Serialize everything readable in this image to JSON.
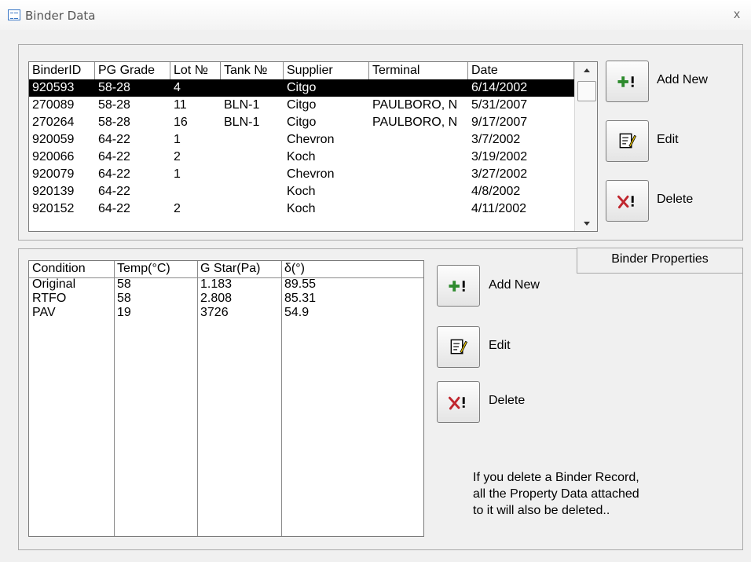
{
  "window": {
    "title": "Binder Data",
    "close_label": "x"
  },
  "binder_list": {
    "columns": [
      "BinderID",
      "PG Grade",
      "Lot №",
      "Tank №",
      "Supplier",
      "Terminal",
      "Date"
    ],
    "rows": [
      [
        "920593",
        "58-28",
        "4",
        "",
        "Citgo",
        "",
        "6/14/2002"
      ],
      [
        "270089",
        "58-28",
        "11",
        "BLN-1",
        "Citgo",
        "PAULBORO, N",
        "5/31/2007"
      ],
      [
        "270264",
        "58-28",
        "16",
        "BLN-1",
        "Citgo",
        "PAULBORO, N",
        "9/17/2007"
      ],
      [
        "920059",
        "64-22",
        "1",
        "",
        "Chevron",
        "",
        "3/7/2002"
      ],
      [
        "920066",
        "64-22",
        "2",
        "",
        "Koch",
        "",
        "3/19/2002"
      ],
      [
        "920079",
        "64-22",
        "1",
        "",
        "Chevron",
        "",
        "3/27/2002"
      ],
      [
        "920139",
        "64-22",
        "",
        "",
        "Koch",
        "",
        "4/8/2002"
      ],
      [
        "920152",
        "64-22",
        "2",
        "",
        "Koch",
        "",
        "4/11/2002"
      ]
    ],
    "selected_index": 0
  },
  "binder_buttons": {
    "add_new": "Add New",
    "edit": "Edit",
    "delete": "Delete"
  },
  "properties_tab": "Binder Properties",
  "property_list": {
    "columns": [
      "Condition",
      "Temp(°C)",
      "G Star(Pa)",
      "δ(°)"
    ],
    "rows": [
      [
        "Original",
        "58",
        "1.183",
        "89.55"
      ],
      [
        "RTFO",
        "58",
        "2.808",
        "85.31"
      ],
      [
        "PAV",
        "19",
        "3726",
        "54.9"
      ]
    ]
  },
  "property_buttons": {
    "add_new": "Add New",
    "edit": "Edit",
    "delete": "Delete"
  },
  "warning": "If you delete a Binder Record,\nall the Property Data attached\nto it will also be deleted..",
  "colors": {
    "selection_bg": "#000000",
    "add_icon": "#2e8b2e",
    "delete_icon": "#c0262e"
  },
  "icons": {
    "add": "plus-exclaim-icon",
    "edit": "edit-note-icon",
    "delete": "x-exclaim-icon",
    "app": "form-icon"
  }
}
